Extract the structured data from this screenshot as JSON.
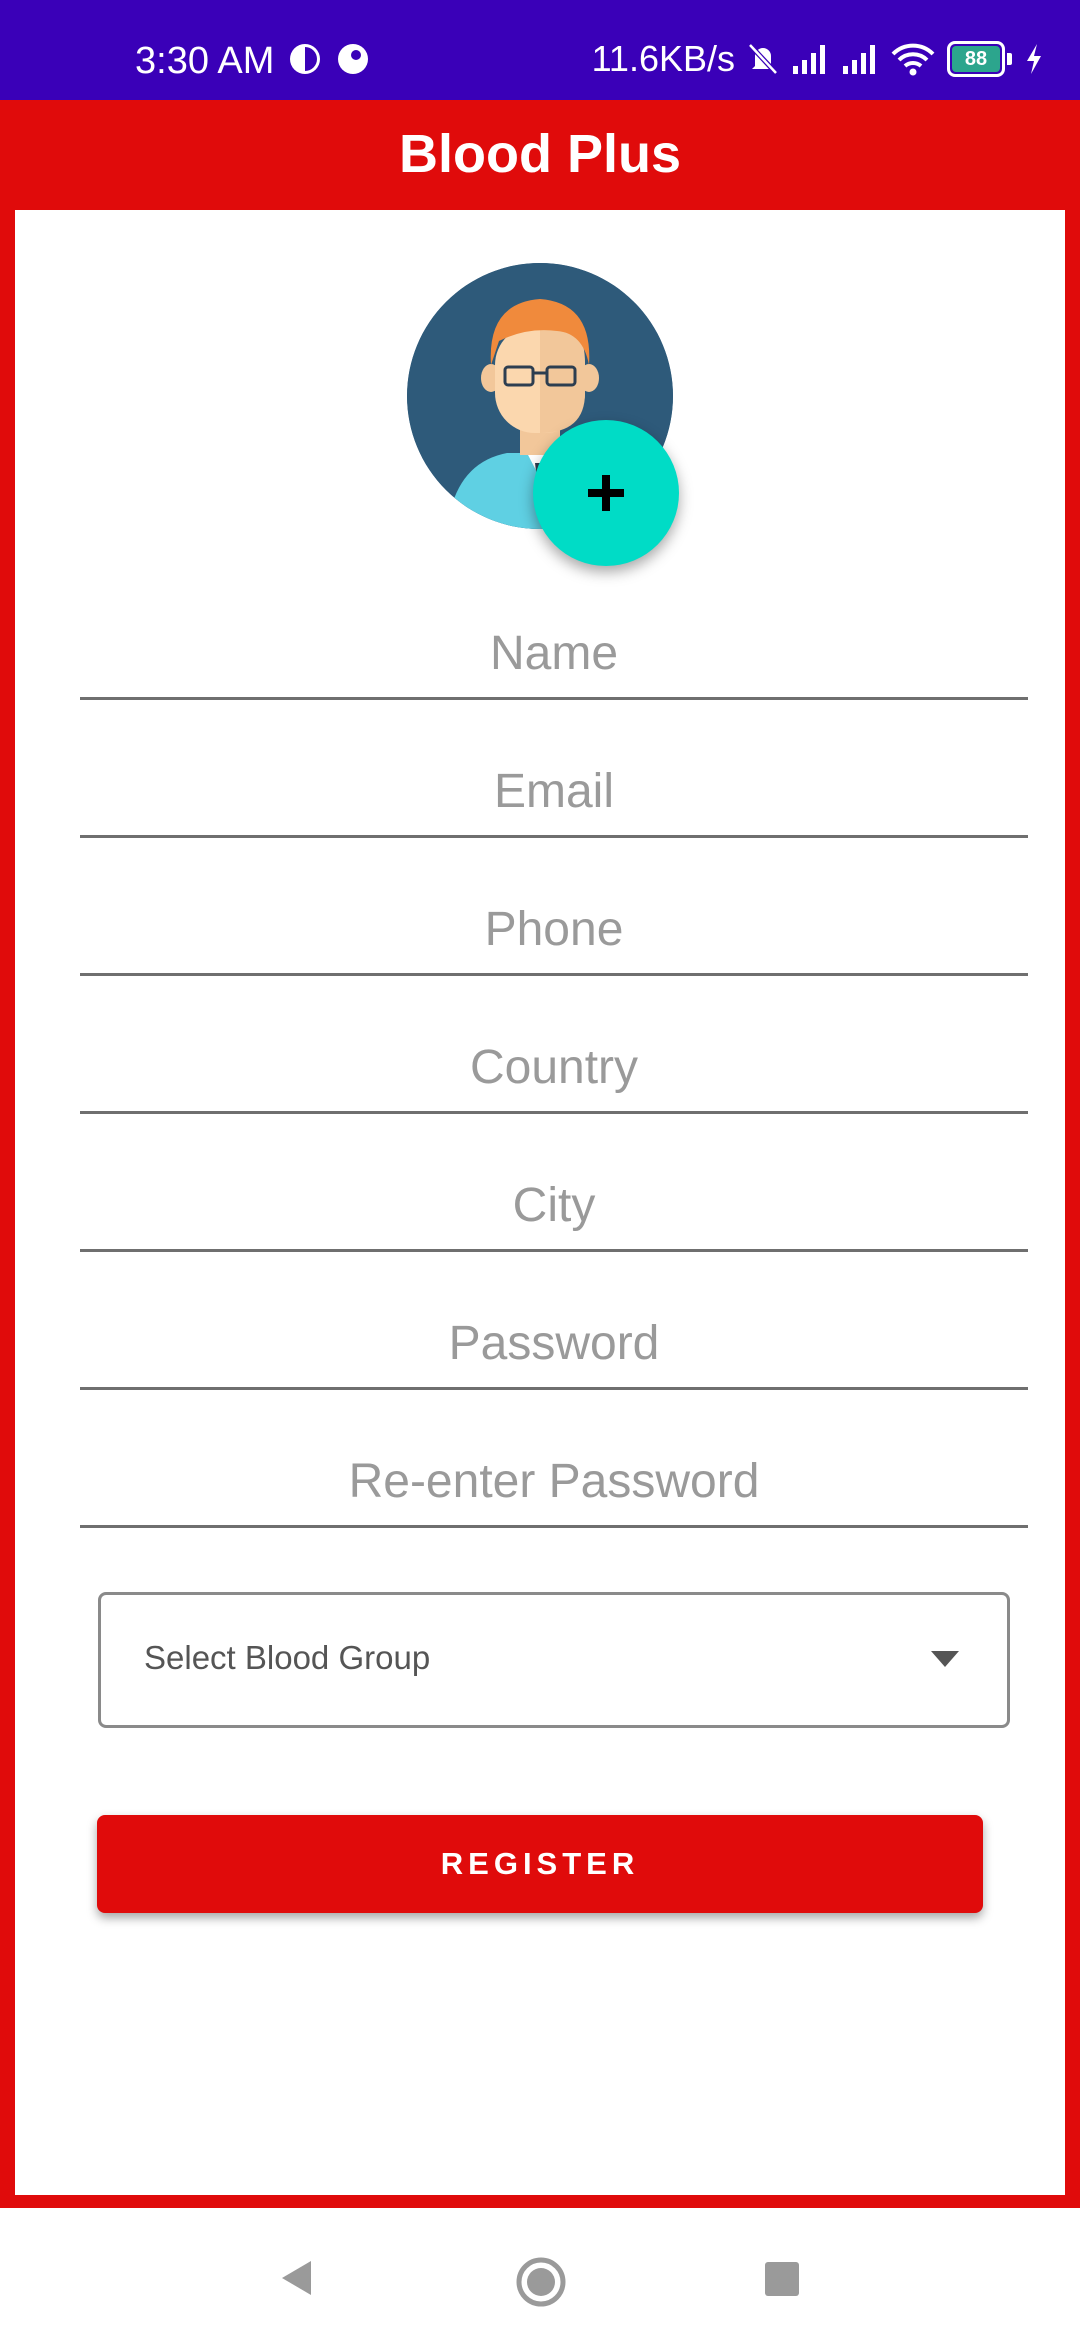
{
  "status_bar": {
    "time": "3:30 AM",
    "speed": "11.6KB/s",
    "battery": "88"
  },
  "app_bar": {
    "title": "Blood Plus"
  },
  "form": {
    "name_placeholder": "Name",
    "email_placeholder": "Email",
    "phone_placeholder": "Phone",
    "country_placeholder": "Country",
    "city_placeholder": "City",
    "password_placeholder": "Password",
    "reenter_password_placeholder": "Re-enter Password",
    "blood_group_select": "Select Blood Group",
    "register_label": "REGISTER"
  },
  "icons": {
    "avatar": "person-avatar-icon",
    "add_photo": "plus-icon",
    "dropdown": "caret-down-icon",
    "nav_back": "back-triangle-icon",
    "nav_home": "home-circle-icon",
    "nav_recent": "recent-square-icon"
  },
  "colors": {
    "primary_red": "#e00b0b",
    "status_bar": "#3a00b8",
    "fab_teal": "#00dcc6"
  }
}
